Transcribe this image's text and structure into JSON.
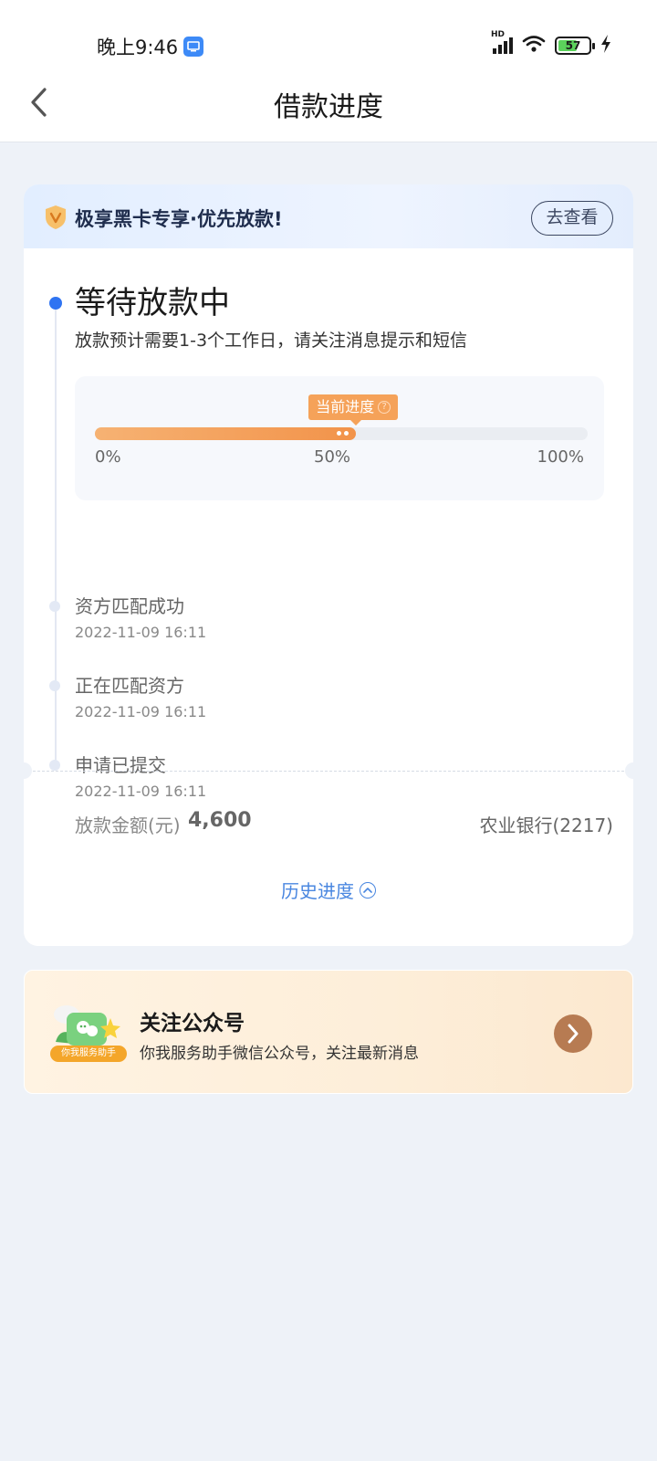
{
  "status_bar": {
    "time": "晚上9:46",
    "network": "HD",
    "battery": "57"
  },
  "nav": {
    "title": "借款进度",
    "back_icon": "chevron-left-icon"
  },
  "banner": {
    "text": "极享黑卡专享·优先放款!",
    "button": "去查看",
    "icon": "v-shield-icon"
  },
  "current_status": {
    "title": "等待放款中",
    "description": "放款预计需要1-3个工作日，请关注消息提示和短信"
  },
  "progress": {
    "tag": "当前进度",
    "value_percent": 53,
    "ticks": [
      "0%",
      "50%",
      "100%"
    ]
  },
  "steps": [
    {
      "title": "资方匹配成功",
      "time": "2022-11-09 16:11"
    },
    {
      "title": "正在匹配资方",
      "time": "2022-11-09 16:11"
    },
    {
      "title": "申请已提交",
      "time": "2022-11-09 16:11"
    }
  ],
  "amount": {
    "label": "放款金额(元)",
    "value": "4,600",
    "bank": "农业银行(2217)"
  },
  "history": {
    "label": "历史进度"
  },
  "follow": {
    "badge": "你我服务助手",
    "title": "关注公众号",
    "description": "你我服务助手微信公众号，关注最新消息"
  },
  "colors": {
    "accent_blue": "#2f74f2",
    "progress_orange": "#f2934a",
    "page_bg": "#eef2f8"
  }
}
